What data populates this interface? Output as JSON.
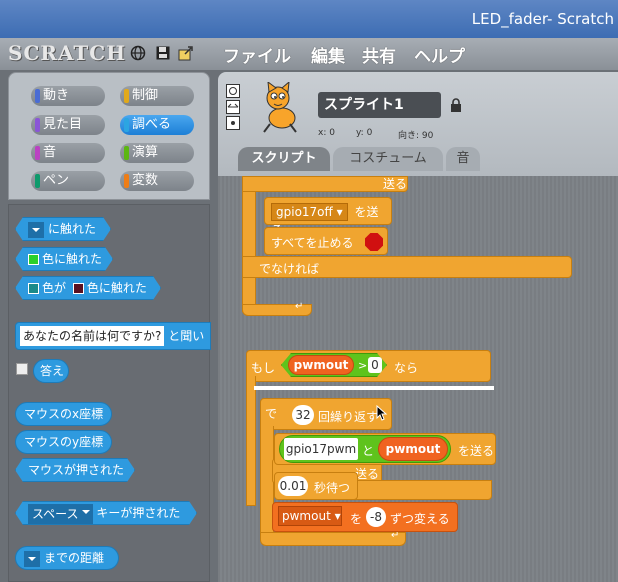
{
  "window": {
    "title": "LED_fader- Scratch"
  },
  "menubar": {
    "logo": "SCRATCH",
    "items": [
      "ファイル",
      "編集",
      "共有",
      "ヘルプ"
    ]
  },
  "categories": [
    {
      "label": "動き",
      "color": "#4a6cd4"
    },
    {
      "label": "制御",
      "color": "#e1a91a"
    },
    {
      "label": "見た目",
      "color": "#8a55d7"
    },
    {
      "label": "調べる",
      "color": "#2ca5e2",
      "selected": true
    },
    {
      "label": "音",
      "color": "#bb42c3"
    },
    {
      "label": "演算",
      "color": "#5cb712"
    },
    {
      "label": "ペン",
      "color": "#0e9a6c"
    },
    {
      "label": "変数",
      "color": "#ee7d16"
    }
  ],
  "palette": {
    "touching": "に触れた",
    "touching_color": "色に触れた",
    "color_touching_a": "色が",
    "color_touching_b": "色に触れた",
    "ask_value": "あなたの名前は何ですか?",
    "ask_suffix": "と聞い",
    "answer": "答え",
    "mouse_x": "マウスのx座標",
    "mouse_y": "マウスのy座標",
    "mouse_down": "マウスが押された",
    "key_value": "スペース",
    "key_suffix": "キーが押された",
    "distance": "までの距離"
  },
  "sprite": {
    "name": "スプライト1",
    "x_label": "x: 0",
    "y_label": "y: 0",
    "direction_label": "向き: 90"
  },
  "tabs": [
    "スクリプト",
    "コスチューム",
    "音"
  ],
  "script": {
    "send1_value": "gpio17off",
    "send_suffix": "を送る",
    "stop_all": "すべてを止める",
    "else": "でなければ",
    "if_label": "もし",
    "if_var": "pwmout",
    "if_op": ">",
    "if_value": "0",
    "if_suffix": "なら",
    "repeat_value": "32",
    "repeat_label": "回繰り返す",
    "send2_text": "gpio17pwm",
    "send2_and": "と",
    "send2_var": "pwmout",
    "send2_suffix": "を送る",
    "hidden_fragment": "送る",
    "wait_value": "0.01",
    "wait_label": "秒待つ",
    "change_var": "pwmout",
    "change_to": "を",
    "change_value": "-8",
    "change_suffix": "ずつ変える"
  }
}
